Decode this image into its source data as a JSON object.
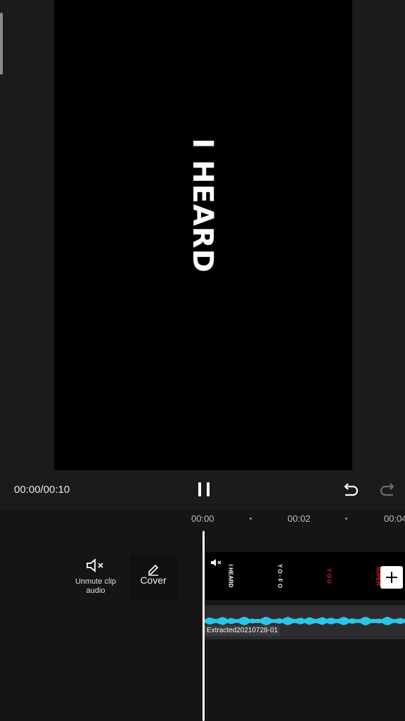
{
  "preview": {
    "overlay_text": "I HEARD"
  },
  "controls": {
    "timecode": "00:00/00:10"
  },
  "timeline": {
    "ruler": [
      "00:00",
      "00:02",
      "00:04"
    ],
    "tools": {
      "unmute_label": "Unmute clip audio",
      "cover_label": "Cover"
    },
    "thumbnails": [
      {
        "text": "I HEARD",
        "color": "#ffffff"
      },
      {
        "text": "Y O · F O",
        "color": "#ffffff"
      },
      {
        "text": "Y O U",
        "color": "#e0202a"
      },
      {
        "text": "SUPER",
        "color": "#e0202a"
      }
    ],
    "audio_label": "Extracted20210728-01",
    "waveform_color": "#2ec4e8"
  }
}
